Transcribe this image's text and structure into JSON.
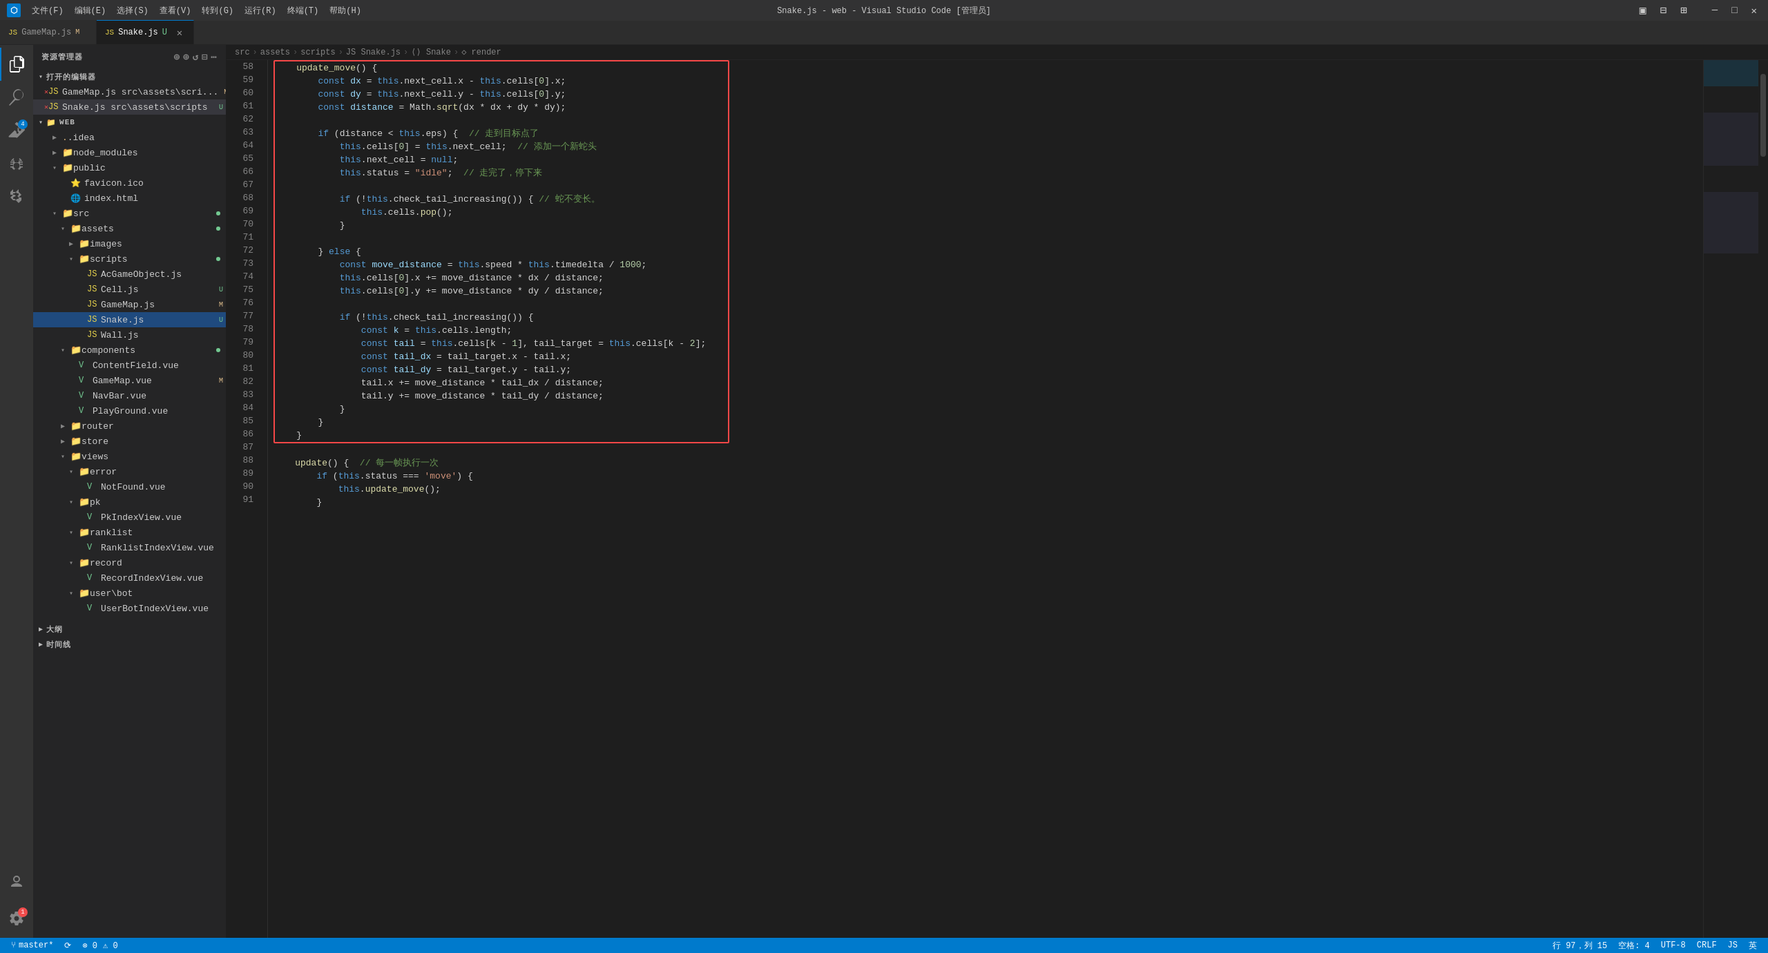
{
  "titleBar": {
    "title": "Snake.js - web - Visual Studio Code [管理员]",
    "menuItems": [
      "文件(F)",
      "编辑(E)",
      "选择(S)",
      "查看(V)",
      "转到(G)",
      "运行(R)",
      "终端(T)",
      "帮助(H)"
    ]
  },
  "tabs": [
    {
      "id": "gamemap",
      "icon": "JS",
      "label": "GameMap.js",
      "badge": "M",
      "active": false
    },
    {
      "id": "snake",
      "icon": "JS",
      "label": "Snake.js",
      "badge": "U",
      "active": true,
      "closable": true
    }
  ],
  "breadcrumb": {
    "items": [
      "src",
      "assets",
      "scripts",
      "JS Snake.js",
      "⟨⟩ Snake",
      "◇ render"
    ]
  },
  "sidebar": {
    "title": "资源管理器",
    "openEditors": "打开的编辑器",
    "files": [
      {
        "type": "file",
        "indent": 1,
        "name": "GameMap.js",
        "path": "src\\assets\\scri...",
        "badge": "M",
        "icon": "JS",
        "close": true
      },
      {
        "type": "file",
        "indent": 1,
        "name": "Snake.js",
        "path": "src\\assets\\scripts",
        "badge": "U",
        "icon": "JS",
        "close": true,
        "selected": true
      },
      {
        "type": "folder",
        "indent": 0,
        "name": "WEB",
        "expanded": true
      },
      {
        "type": "folder",
        "indent": 1,
        "name": ".idea",
        "expanded": false
      },
      {
        "type": "folder",
        "indent": 1,
        "name": "node_modules",
        "expanded": false
      },
      {
        "type": "folder",
        "indent": 1,
        "name": "public",
        "expanded": true
      },
      {
        "type": "file",
        "indent": 2,
        "name": "favicon.ico",
        "icon": "⭐"
      },
      {
        "type": "file",
        "indent": 2,
        "name": "index.html",
        "icon": "🌐"
      },
      {
        "type": "folder",
        "indent": 1,
        "name": "src",
        "expanded": true,
        "dot": true
      },
      {
        "type": "folder",
        "indent": 2,
        "name": "assets",
        "expanded": true,
        "dot": true
      },
      {
        "type": "folder",
        "indent": 3,
        "name": "images",
        "expanded": false
      },
      {
        "type": "folder",
        "indent": 3,
        "name": "scripts",
        "expanded": true,
        "dot": true
      },
      {
        "type": "file",
        "indent": 4,
        "name": "AcGameObject.js",
        "icon": "JS"
      },
      {
        "type": "file",
        "indent": 4,
        "name": "Cell.js",
        "icon": "JS",
        "badge": "U"
      },
      {
        "type": "file",
        "indent": 4,
        "name": "GameMap.js",
        "icon": "JS",
        "badge": "M"
      },
      {
        "type": "file",
        "indent": 4,
        "name": "Snake.js",
        "icon": "JS",
        "badge": "U",
        "highlighted": true
      },
      {
        "type": "file",
        "indent": 4,
        "name": "Wall.js",
        "icon": "JS"
      },
      {
        "type": "folder",
        "indent": 2,
        "name": "components",
        "expanded": true,
        "dot": true
      },
      {
        "type": "file",
        "indent": 3,
        "name": "ContentField.vue",
        "icon": "V"
      },
      {
        "type": "file",
        "indent": 3,
        "name": "GameMap.vue",
        "icon": "V",
        "badge": "M"
      },
      {
        "type": "file",
        "indent": 3,
        "name": "NavBar.vue",
        "icon": "V"
      },
      {
        "type": "file",
        "indent": 3,
        "name": "PlayGround.vue",
        "icon": "V"
      },
      {
        "type": "folder",
        "indent": 2,
        "name": "router",
        "expanded": false
      },
      {
        "type": "folder",
        "indent": 2,
        "name": "store",
        "expanded": false
      },
      {
        "type": "folder",
        "indent": 2,
        "name": "views",
        "expanded": true
      },
      {
        "type": "folder",
        "indent": 3,
        "name": "error",
        "expanded": true
      },
      {
        "type": "file",
        "indent": 4,
        "name": "NotFound.vue",
        "icon": "V"
      },
      {
        "type": "folder",
        "indent": 3,
        "name": "pk",
        "expanded": true
      },
      {
        "type": "file",
        "indent": 4,
        "name": "PkIndexView.vue",
        "icon": "V"
      },
      {
        "type": "folder",
        "indent": 3,
        "name": "ranklist",
        "expanded": true
      },
      {
        "type": "file",
        "indent": 4,
        "name": "RanklistIndexView.vue",
        "icon": "V"
      },
      {
        "type": "folder",
        "indent": 3,
        "name": "record",
        "expanded": true
      },
      {
        "type": "file",
        "indent": 4,
        "name": "RecordIndexView.vue",
        "icon": "V"
      },
      {
        "type": "folder",
        "indent": 3,
        "name": "user\\bot",
        "expanded": true
      },
      {
        "type": "file",
        "indent": 4,
        "name": "UserBotIndexView.vue",
        "icon": "V"
      }
    ]
  },
  "bottomSidebar": [
    {
      "label": "大纲"
    },
    {
      "label": "时间线"
    }
  ],
  "code": {
    "startLine": 58,
    "lines": [
      {
        "num": 58,
        "tokens": [
          {
            "text": "    update_move() {",
            "class": ""
          }
        ]
      },
      {
        "num": 59,
        "tokens": [
          {
            "text": "        ",
            "class": ""
          },
          {
            "text": "const",
            "class": "kw"
          },
          {
            "text": " dx = ",
            "class": ""
          },
          {
            "text": "this",
            "class": "this-kw"
          },
          {
            "text": ".next_cell.x - ",
            "class": ""
          },
          {
            "text": "this",
            "class": "this-kw"
          },
          {
            "text": ".cells[",
            "class": ""
          },
          {
            "text": "0",
            "class": "num"
          },
          {
            "text": "].x;",
            "class": ""
          }
        ]
      },
      {
        "num": 60,
        "tokens": [
          {
            "text": "        ",
            "class": ""
          },
          {
            "text": "const",
            "class": "kw"
          },
          {
            "text": " dy = ",
            "class": ""
          },
          {
            "text": "this",
            "class": "this-kw"
          },
          {
            "text": ".next_cell.y - ",
            "class": ""
          },
          {
            "text": "this",
            "class": "this-kw"
          },
          {
            "text": ".cells[",
            "class": ""
          },
          {
            "text": "0",
            "class": "num"
          },
          {
            "text": "].y;",
            "class": ""
          }
        ]
      },
      {
        "num": 61,
        "tokens": [
          {
            "text": "        ",
            "class": ""
          },
          {
            "text": "const",
            "class": "kw"
          },
          {
            "text": " distance = Math.",
            "class": ""
          },
          {
            "text": "sqrt",
            "class": "fn"
          },
          {
            "text": "(dx * dx + dy * dy);",
            "class": ""
          }
        ]
      },
      {
        "num": 62,
        "tokens": [
          {
            "text": "",
            "class": ""
          }
        ]
      },
      {
        "num": 63,
        "tokens": [
          {
            "text": "        ",
            "class": ""
          },
          {
            "text": "if",
            "class": "kw"
          },
          {
            "text": " (distance < ",
            "class": ""
          },
          {
            "text": "this",
            "class": "this-kw"
          },
          {
            "text": ".eps) {  ",
            "class": ""
          },
          {
            "text": "// 走到目标点了",
            "class": "cm"
          }
        ]
      },
      {
        "num": 64,
        "tokens": [
          {
            "text": "            ",
            "class": ""
          },
          {
            "text": "this",
            "class": "this-kw"
          },
          {
            "text": ".cells[",
            "class": ""
          },
          {
            "text": "0",
            "class": "num"
          },
          {
            "text": "] = ",
            "class": ""
          },
          {
            "text": "this",
            "class": "this-kw"
          },
          {
            "text": ".next_cell;  ",
            "class": ""
          },
          {
            "text": "// 添加一个新蛇头",
            "class": "cm"
          }
        ]
      },
      {
        "num": 65,
        "tokens": [
          {
            "text": "            ",
            "class": ""
          },
          {
            "text": "this",
            "class": "this-kw"
          },
          {
            "text": ".next_cell = ",
            "class": ""
          },
          {
            "text": "null",
            "class": "kw"
          },
          {
            "text": ";",
            "class": ""
          }
        ]
      },
      {
        "num": 66,
        "tokens": [
          {
            "text": "            ",
            "class": ""
          },
          {
            "text": "this",
            "class": "this-kw"
          },
          {
            "text": ".status = ",
            "class": ""
          },
          {
            "text": "\"idle\"",
            "class": "str"
          },
          {
            "text": ";  ",
            "class": ""
          },
          {
            "text": "// 走完了，停下来",
            "class": "cm"
          }
        ]
      },
      {
        "num": 67,
        "tokens": [
          {
            "text": "",
            "class": ""
          }
        ]
      },
      {
        "num": 68,
        "tokens": [
          {
            "text": "            ",
            "class": ""
          },
          {
            "text": "if",
            "class": "kw"
          },
          {
            "text": " (!",
            "class": ""
          },
          {
            "text": "this",
            "class": "this-kw"
          },
          {
            "text": ".check_tail_increasing()) { ",
            "class": ""
          },
          {
            "text": "// 蛇不变长。",
            "class": "cm"
          }
        ]
      },
      {
        "num": 69,
        "tokens": [
          {
            "text": "                ",
            "class": ""
          },
          {
            "text": "this",
            "class": "this-kw"
          },
          {
            "text": ".cells.",
            "class": ""
          },
          {
            "text": "pop",
            "class": "fn"
          },
          {
            "text": "();",
            "class": ""
          }
        ]
      },
      {
        "num": 70,
        "tokens": [
          {
            "text": "            }",
            "class": ""
          }
        ]
      },
      {
        "num": 71,
        "tokens": [
          {
            "text": "",
            "class": ""
          }
        ]
      },
      {
        "num": 72,
        "tokens": [
          {
            "text": "        } ",
            "class": ""
          },
          {
            "text": "else",
            "class": "kw"
          },
          {
            "text": " {",
            "class": ""
          }
        ]
      },
      {
        "num": 73,
        "tokens": [
          {
            "text": "            ",
            "class": ""
          },
          {
            "text": "const",
            "class": "kw"
          },
          {
            "text": " move_distance = ",
            "class": ""
          },
          {
            "text": "this",
            "class": "this-kw"
          },
          {
            "text": ".speed * ",
            "class": ""
          },
          {
            "text": "this",
            "class": "this-kw"
          },
          {
            "text": ".timedelta / ",
            "class": ""
          },
          {
            "text": "1000",
            "class": "num"
          },
          {
            "text": ";",
            "class": ""
          }
        ]
      },
      {
        "num": 74,
        "tokens": [
          {
            "text": "            ",
            "class": ""
          },
          {
            "text": "this",
            "class": "this-kw"
          },
          {
            "text": ".cells[",
            "class": ""
          },
          {
            "text": "0",
            "class": "num"
          },
          {
            "text": "].x += move_distance * dx / distance;",
            "class": ""
          }
        ]
      },
      {
        "num": 75,
        "tokens": [
          {
            "text": "            ",
            "class": ""
          },
          {
            "text": "this",
            "class": "this-kw"
          },
          {
            "text": ".cells[",
            "class": ""
          },
          {
            "text": "0",
            "class": "num"
          },
          {
            "text": "].y += move_distance * dy / distance;",
            "class": ""
          }
        ]
      },
      {
        "num": 76,
        "tokens": [
          {
            "text": "",
            "class": ""
          }
        ]
      },
      {
        "num": 77,
        "tokens": [
          {
            "text": "            ",
            "class": ""
          },
          {
            "text": "if",
            "class": "kw"
          },
          {
            "text": " (!",
            "class": ""
          },
          {
            "text": "this",
            "class": "this-kw"
          },
          {
            "text": ".check_tail_increasing()) {",
            "class": ""
          }
        ]
      },
      {
        "num": 78,
        "tokens": [
          {
            "text": "                ",
            "class": ""
          },
          {
            "text": "const",
            "class": "kw"
          },
          {
            "text": " k = ",
            "class": ""
          },
          {
            "text": "this",
            "class": "this-kw"
          },
          {
            "text": ".cells.length;",
            "class": ""
          }
        ]
      },
      {
        "num": 79,
        "tokens": [
          {
            "text": "                ",
            "class": ""
          },
          {
            "text": "const",
            "class": "kw"
          },
          {
            "text": " tail = ",
            "class": ""
          },
          {
            "text": "this",
            "class": "this-kw"
          },
          {
            "text": ".cells[k - ",
            "class": ""
          },
          {
            "text": "1",
            "class": "num"
          },
          {
            "text": "], tail_target = ",
            "class": ""
          },
          {
            "text": "this",
            "class": "this-kw"
          },
          {
            "text": ".cells[k - ",
            "class": ""
          },
          {
            "text": "2",
            "class": "num"
          },
          {
            "text": "];",
            "class": ""
          }
        ]
      },
      {
        "num": 80,
        "tokens": [
          {
            "text": "                ",
            "class": ""
          },
          {
            "text": "const",
            "class": "kw"
          },
          {
            "text": " tail_dx = tail_target.x - tail.x;",
            "class": ""
          }
        ]
      },
      {
        "num": 81,
        "tokens": [
          {
            "text": "                ",
            "class": ""
          },
          {
            "text": "const",
            "class": "kw"
          },
          {
            "text": " tail_dy = tail_target.y - tail.y;",
            "class": ""
          }
        ]
      },
      {
        "num": 82,
        "tokens": [
          {
            "text": "                tail.x += move_distance * tail_dx / distance;",
            "class": ""
          }
        ]
      },
      {
        "num": 83,
        "tokens": [
          {
            "text": "                tail.y += move_distance * tail_dy / distance;",
            "class": ""
          }
        ]
      },
      {
        "num": 84,
        "tokens": [
          {
            "text": "            }",
            "class": ""
          }
        ]
      },
      {
        "num": 85,
        "tokens": [
          {
            "text": "        }",
            "class": ""
          }
        ]
      },
      {
        "num": 86,
        "tokens": [
          {
            "text": "    }",
            "class": ""
          }
        ]
      },
      {
        "num": 87,
        "tokens": [
          {
            "text": "",
            "class": ""
          }
        ]
      },
      {
        "num": 88,
        "tokens": [
          {
            "text": "    update() {  ",
            "class": ""
          },
          {
            "text": "// 每一帧执行一次",
            "class": "cm"
          }
        ]
      },
      {
        "num": 89,
        "tokens": [
          {
            "text": "        ",
            "class": ""
          },
          {
            "text": "if",
            "class": "kw"
          },
          {
            "text": " (",
            "class": ""
          },
          {
            "text": "this",
            "class": "this-kw"
          },
          {
            "text": ".status === ",
            "class": ""
          },
          {
            "text": "'move'",
            "class": "str"
          },
          {
            "text": ") {",
            "class": ""
          }
        ]
      },
      {
        "num": 90,
        "tokens": [
          {
            "text": "            ",
            "class": ""
          },
          {
            "text": "this",
            "class": "this-kw"
          },
          {
            "text": ".update_move();",
            "class": ""
          }
        ]
      },
      {
        "num": 91,
        "tokens": [
          {
            "text": "        }",
            "class": ""
          }
        ]
      }
    ]
  },
  "statusBar": {
    "branch": "master*",
    "sync": "⟳",
    "errors": "⊗ 0",
    "warnings": "⚠ 0",
    "position": "行 97，列 15",
    "spaces": "空格: 4",
    "encoding": "UTF-8",
    "lineEnding": "CRLF",
    "language": "JS",
    "feedback": "英"
  },
  "colors": {
    "accent": "#007acc",
    "bg": "#1e1e1e",
    "sidebar": "#252526",
    "tabBar": "#2d2d2d",
    "activityBar": "#333333",
    "statusBar": "#007acc",
    "selectionBorder": "#f44747"
  }
}
